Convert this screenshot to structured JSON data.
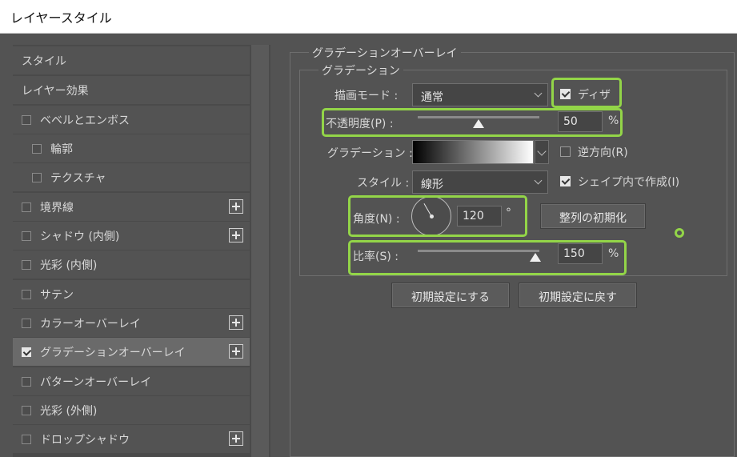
{
  "window": {
    "title": "レイヤースタイル"
  },
  "sidebar": {
    "items": [
      {
        "label": "スタイル",
        "has_checkbox": false,
        "checked": false,
        "has_plus": false
      },
      {
        "label": "レイヤー効果",
        "has_checkbox": false,
        "checked": false,
        "has_plus": false
      },
      {
        "label": "ベベルとエンボス",
        "has_checkbox": true,
        "checked": false,
        "has_plus": false
      },
      {
        "label": "輪郭",
        "has_checkbox": true,
        "checked": false,
        "has_plus": false
      },
      {
        "label": "テクスチャ",
        "has_checkbox": true,
        "checked": false,
        "has_plus": false
      },
      {
        "label": "境界線",
        "has_checkbox": true,
        "checked": false,
        "has_plus": true
      },
      {
        "label": "シャドウ (内側)",
        "has_checkbox": true,
        "checked": false,
        "has_plus": true
      },
      {
        "label": "光彩 (内側)",
        "has_checkbox": true,
        "checked": false,
        "has_plus": false
      },
      {
        "label": "サテン",
        "has_checkbox": true,
        "checked": false,
        "has_plus": false
      },
      {
        "label": "カラーオーバーレイ",
        "has_checkbox": true,
        "checked": false,
        "has_plus": true
      },
      {
        "label": "グラデーションオーバーレイ",
        "has_checkbox": true,
        "checked": true,
        "has_plus": true
      },
      {
        "label": "パターンオーバーレイ",
        "has_checkbox": true,
        "checked": false,
        "has_plus": false
      },
      {
        "label": "光彩 (外側)",
        "has_checkbox": true,
        "checked": false,
        "has_plus": false
      },
      {
        "label": "ドロップシャドウ",
        "has_checkbox": true,
        "checked": false,
        "has_plus": true
      }
    ]
  },
  "panel": {
    "outer_title": "グラデーションオーバーレイ",
    "inner_title": "グラデーション",
    "blend_mode": {
      "label": "描画モード :",
      "value": "通常"
    },
    "dither": {
      "label": "ディザ",
      "checked": true
    },
    "opacity": {
      "label": "不透明度(P) :",
      "value": "50",
      "unit": "%",
      "fraction": 0.5
    },
    "gradient": {
      "label": "グラデーション :",
      "start_color": "#000000",
      "end_color": "#ffffff"
    },
    "reverse": {
      "label": "逆方向(R)",
      "checked": false
    },
    "style": {
      "label": "スタイル :",
      "value": "線形"
    },
    "align_with_layer": {
      "label": "シェイプ内で作成(I)",
      "checked": true
    },
    "angle": {
      "label": "角度(N) :",
      "value": "120",
      "unit": "°"
    },
    "reset_alignment_button": "整列の初期化",
    "scale": {
      "label": "比率(S) :",
      "value": "150",
      "unit": "%",
      "fraction": 0.97
    },
    "make_default_button": "初期設定にする",
    "reset_default_button": "初期設定に戻す"
  },
  "colors": {
    "highlight": "#93d548",
    "background": "#535353",
    "sidebar_selected": "#6a6a6a"
  }
}
